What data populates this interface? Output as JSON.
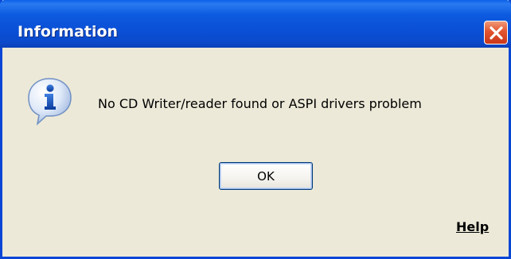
{
  "window": {
    "title": "Information",
    "close_icon": "close-icon",
    "accent_color": "#0a46d6"
  },
  "dialog": {
    "icon": "info-icon",
    "message": "No CD Writer/reader found or ASPI drivers problem",
    "ok_label": "OK",
    "help_label": "Help"
  }
}
